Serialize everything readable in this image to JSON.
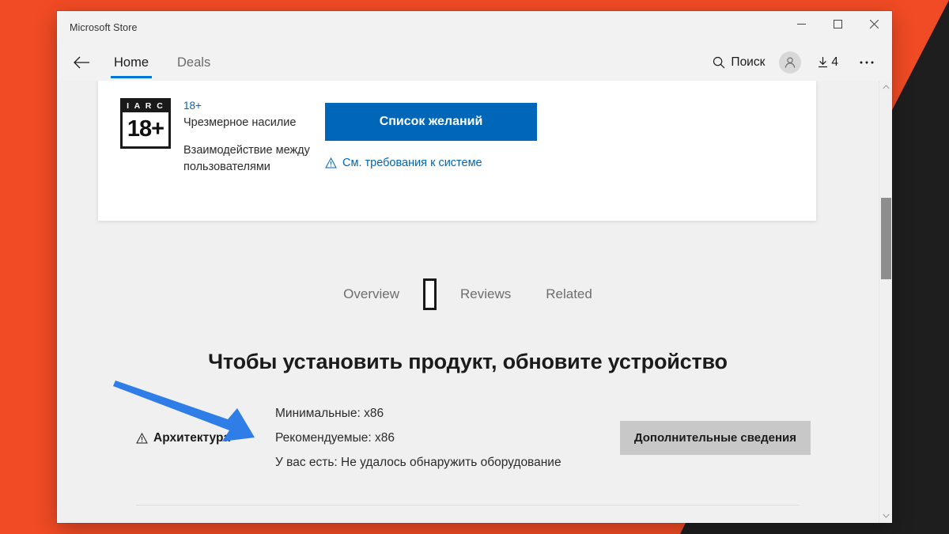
{
  "desktop": {
    "background_color": "#F04B24",
    "shape_color": "#1E1E1E"
  },
  "window": {
    "title": "Microsoft Store",
    "caption": {
      "minimize": "minimize-icon",
      "maximize": "maximize-icon",
      "close": "close-icon"
    }
  },
  "commandbar": {
    "back_icon": "back-arrow-icon",
    "tabs": [
      {
        "label": "Home",
        "selected": true
      },
      {
        "label": "Deals",
        "selected": false
      }
    ],
    "search_label": "Поиск",
    "search_icon": "search-icon",
    "avatar_icon": "user-avatar-icon",
    "downloads_icon": "download-icon",
    "downloads_count": "4",
    "more_icon": "more-ellipsis-icon"
  },
  "rating_card": {
    "badge": {
      "top": "I A R C",
      "bottom": "18+"
    },
    "age": "18+",
    "descriptor": "Чрезмерное насилие",
    "interaction": "Взаимодействие между пользователями",
    "wishlist_button": "Список желаний",
    "system_requirements_link": "См. требования к системе",
    "warning_icon": "warning-triangle-icon",
    "accent_color": "#0067B8"
  },
  "pivot": {
    "items": [
      {
        "label": "Overview"
      },
      {
        "label": "\u0000",
        "missing_glyph": true
      },
      {
        "label": "Reviews"
      },
      {
        "label": "Related"
      }
    ]
  },
  "main": {
    "heading": "Чтобы установить продукт, обновите устройство",
    "requirement": {
      "label": "Архитектура",
      "warning_icon": "warning-triangle-icon",
      "minimum": "Минимальные: x86",
      "recommended": "Рекомендуемые: x86",
      "current": "У вас есть: Не удалось обнаружить оборудование"
    },
    "more_info_button": "Дополнительные сведения"
  },
  "scrollbar": {
    "up_arrow": "chevron-up-icon",
    "down_arrow": "chevron-down-icon",
    "thumb": "scrollbar-thumb"
  },
  "annotation": {
    "arrow_color": "#2F7EE8",
    "arrow_icon": "pointer-arrow-annotation"
  }
}
